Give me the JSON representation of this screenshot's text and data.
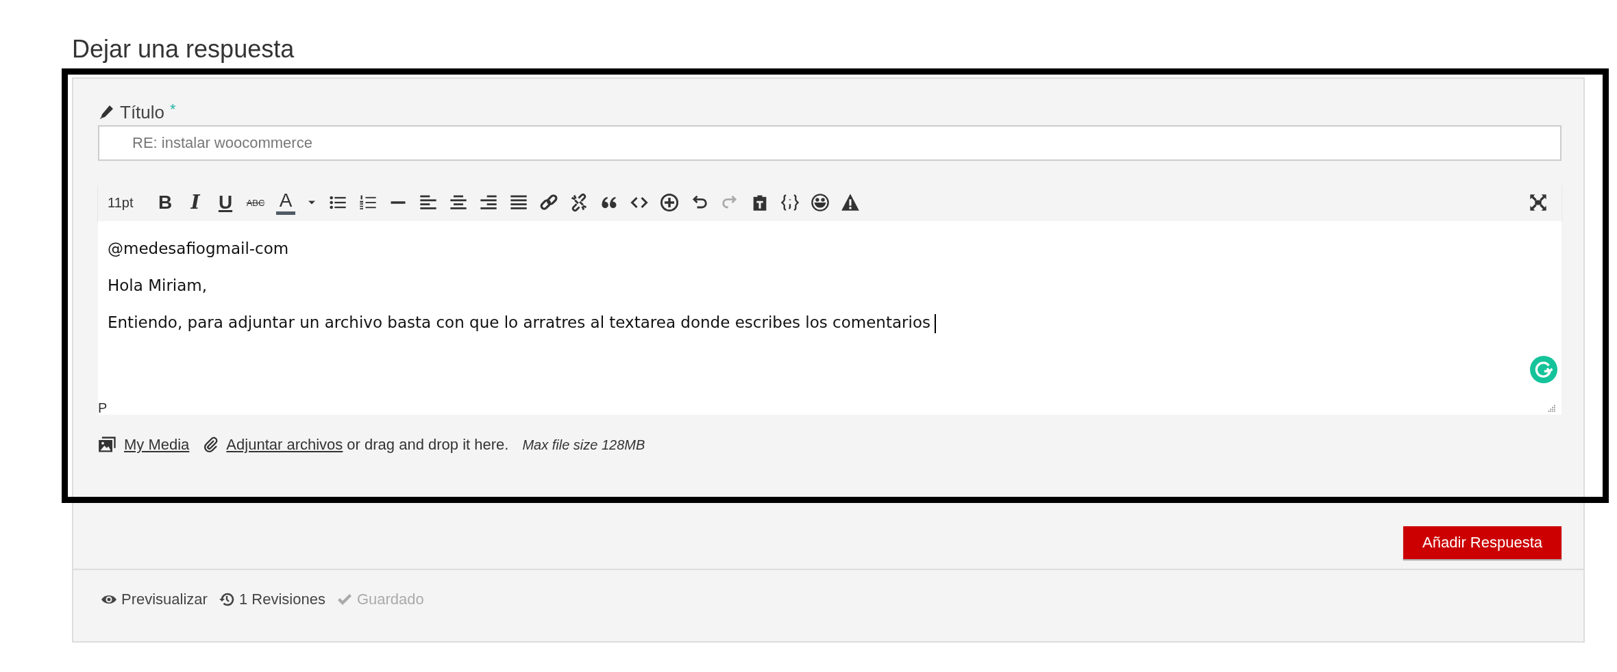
{
  "heading": "Dejar una respuesta",
  "title_field": {
    "label": "Título",
    "required_mark": "*",
    "value": "RE: instalar woocommerce"
  },
  "toolbar": {
    "font_size": "11pt",
    "buttons": [
      {
        "kind": "bold",
        "label": "B",
        "disabled": false
      },
      {
        "kind": "italic",
        "label": "I",
        "disabled": false
      },
      {
        "kind": "underline",
        "label": "U",
        "disabled": false
      },
      {
        "kind": "strike",
        "label": "ABC",
        "disabled": false
      },
      {
        "kind": "fontcolor",
        "label": "A",
        "disabled": false
      },
      {
        "kind": "dropdown",
        "disabled": false
      },
      {
        "kind": "bullist",
        "disabled": false
      },
      {
        "kind": "numlist",
        "disabled": false
      },
      {
        "kind": "hr",
        "disabled": false
      },
      {
        "kind": "alignleft",
        "disabled": false
      },
      {
        "kind": "aligncenter",
        "disabled": false
      },
      {
        "kind": "alignright",
        "disabled": false
      },
      {
        "kind": "justify",
        "disabled": false
      },
      {
        "kind": "link",
        "disabled": false
      },
      {
        "kind": "unlink",
        "disabled": false
      },
      {
        "kind": "quote",
        "disabled": false
      },
      {
        "kind": "code",
        "disabled": false
      },
      {
        "kind": "insert",
        "disabled": false
      },
      {
        "kind": "undo",
        "disabled": false
      },
      {
        "kind": "redo",
        "disabled": true
      },
      {
        "kind": "paste",
        "disabled": false
      },
      {
        "kind": "codesample",
        "disabled": false
      },
      {
        "kind": "emoji",
        "disabled": false
      },
      {
        "kind": "warning",
        "disabled": false
      }
    ]
  },
  "editor": {
    "paragraphs": [
      "@medesafiogmail-com",
      "Hola Miriam,",
      "Entiendo, para adjuntar un archivo basta con que lo arratres al textarea donde escribes los comentarios"
    ],
    "caret_visible": true,
    "status_path": "P"
  },
  "attachments": {
    "media_link": "My Media",
    "attach_link": "Adjuntar archivos",
    "drop_hint": "or drag and drop it here.",
    "max_size": "Max file size 128MB"
  },
  "submit_button": "Añadir Respuesta",
  "footer": [
    {
      "kind": "preview",
      "label": "Previsualizar",
      "disabled": false
    },
    {
      "kind": "revisions",
      "label": "1 Revisiones",
      "disabled": false
    },
    {
      "kind": "saved",
      "label": "Guardado",
      "disabled": true
    }
  ]
}
